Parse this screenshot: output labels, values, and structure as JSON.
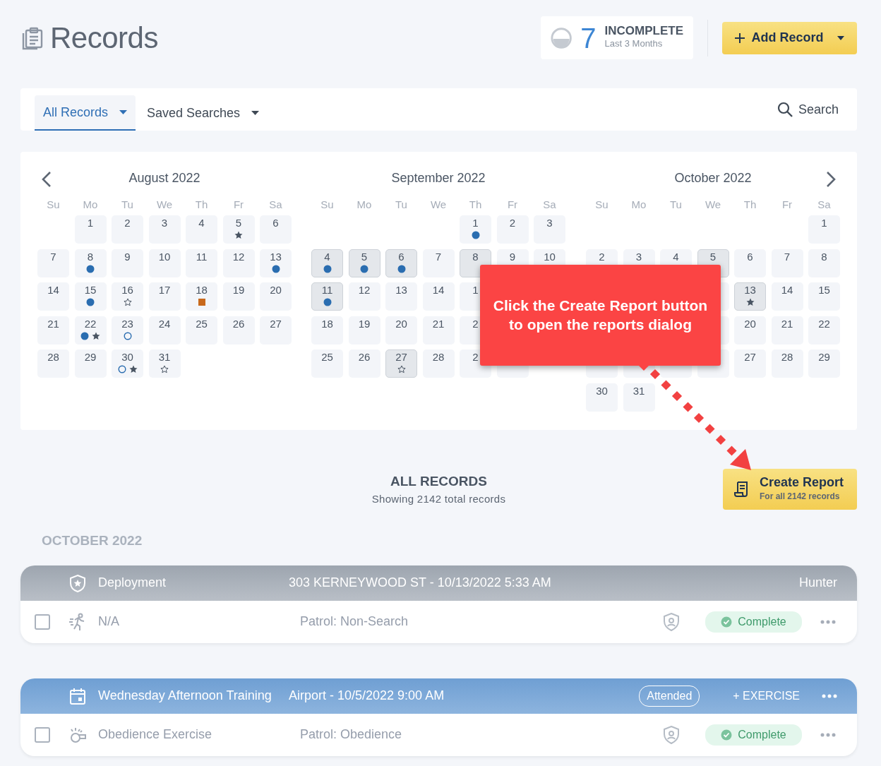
{
  "header": {
    "title": "Records",
    "incomplete": {
      "count": "7",
      "label": "INCOMPLETE",
      "period": "Last 3 Months"
    },
    "add_button": "Add Record"
  },
  "tabs": [
    {
      "label": "All Records",
      "selected": true
    },
    {
      "label": "Saved Searches",
      "selected": false
    }
  ],
  "search": "Search",
  "calendar": {
    "months": [
      {
        "title": "August 2022",
        "weekdays": [
          "Su",
          "Mo",
          "Tu",
          "We",
          "Th",
          "Fr",
          "Sa"
        ],
        "weeks": [
          [
            {
              "kind": "blank"
            },
            {
              "kind": "day",
              "day": "1",
              "selected": false
            },
            {
              "kind": "day",
              "day": "2",
              "selected": false
            },
            {
              "kind": "day",
              "day": "3",
              "selected": false
            },
            {
              "kind": "day",
              "day": "4",
              "selected": false
            },
            {
              "kind": "day",
              "day": "5",
              "selected": false,
              "marks": [
                {
                  "kind": "star"
                }
              ]
            },
            {
              "kind": "day",
              "day": "6",
              "selected": false
            }
          ],
          [
            {
              "kind": "day",
              "day": "7",
              "selected": false
            },
            {
              "kind": "day",
              "day": "8",
              "selected": false,
              "marks": [
                {
                  "kind": "dot"
                }
              ]
            },
            {
              "kind": "day",
              "day": "9",
              "selected": false
            },
            {
              "kind": "day",
              "day": "10",
              "selected": false
            },
            {
              "kind": "day",
              "day": "11",
              "selected": false
            },
            {
              "kind": "day",
              "day": "12",
              "selected": false
            },
            {
              "kind": "day",
              "day": "13",
              "selected": false,
              "marks": [
                {
                  "kind": "dot"
                }
              ]
            }
          ],
          [
            {
              "kind": "day",
              "day": "14",
              "selected": false
            },
            {
              "kind": "day",
              "day": "15",
              "selected": false,
              "marks": [
                {
                  "kind": "dot"
                }
              ]
            },
            {
              "kind": "day",
              "day": "16",
              "selected": false,
              "marks": [
                {
                  "kind": "star-outline"
                }
              ]
            },
            {
              "kind": "day",
              "day": "17",
              "selected": false
            },
            {
              "kind": "day",
              "day": "18",
              "selected": false,
              "marks": [
                {
                  "kind": "square"
                }
              ]
            },
            {
              "kind": "day",
              "day": "19",
              "selected": false
            },
            {
              "kind": "day",
              "day": "20",
              "selected": false
            }
          ],
          [
            {
              "kind": "day",
              "day": "21",
              "selected": false
            },
            {
              "kind": "day",
              "day": "22",
              "selected": false,
              "marks": [
                {
                  "kind": "dot"
                },
                {
                  "kind": "star"
                }
              ]
            },
            {
              "kind": "day",
              "day": "23",
              "selected": false,
              "marks": [
                {
                  "kind": "ring"
                }
              ]
            },
            {
              "kind": "day",
              "day": "24",
              "selected": false
            },
            {
              "kind": "day",
              "day": "25",
              "selected": false
            },
            {
              "kind": "day",
              "day": "26",
              "selected": false
            },
            {
              "kind": "day",
              "day": "27",
              "selected": false
            }
          ],
          [
            {
              "kind": "day",
              "day": "28",
              "selected": false
            },
            {
              "kind": "day",
              "day": "29",
              "selected": false
            },
            {
              "kind": "day",
              "day": "30",
              "selected": false,
              "marks": [
                {
                  "kind": "ring"
                },
                {
                  "kind": "star"
                }
              ]
            },
            {
              "kind": "day",
              "day": "31",
              "selected": false,
              "marks": [
                {
                  "kind": "star-outline"
                }
              ]
            }
          ]
        ]
      },
      {
        "title": "September 2022",
        "weekdays": [
          "Su",
          "Mo",
          "Tu",
          "We",
          "Th",
          "Fr",
          "Sa"
        ],
        "weeks": [
          [
            {
              "kind": "blank"
            },
            {
              "kind": "blank"
            },
            {
              "kind": "blank"
            },
            {
              "kind": "blank"
            },
            {
              "kind": "day",
              "day": "1",
              "selected": false,
              "marks": [
                {
                  "kind": "dot"
                }
              ]
            },
            {
              "kind": "day",
              "day": "2",
              "selected": false
            },
            {
              "kind": "day",
              "day": "3",
              "selected": false
            }
          ],
          [
            {
              "kind": "day",
              "day": "4",
              "selected": true,
              "marks": [
                {
                  "kind": "dot"
                }
              ]
            },
            {
              "kind": "day",
              "day": "5",
              "selected": true,
              "marks": [
                {
                  "kind": "dot"
                }
              ]
            },
            {
              "kind": "day",
              "day": "6",
              "selected": true,
              "marks": [
                {
                  "kind": "dot"
                }
              ]
            },
            {
              "kind": "day",
              "day": "7",
              "selected": false
            },
            {
              "kind": "day",
              "day": "8",
              "selected": true
            },
            {
              "kind": "day",
              "day": "9",
              "selected": false
            },
            {
              "kind": "day",
              "day": "10",
              "selected": false
            }
          ],
          [
            {
              "kind": "day",
              "day": "11",
              "selected": true,
              "marks": [
                {
                  "kind": "dot"
                }
              ]
            },
            {
              "kind": "day",
              "day": "12",
              "selected": false
            },
            {
              "kind": "day",
              "day": "13",
              "selected": false
            },
            {
              "kind": "day",
              "day": "14",
              "selected": false
            },
            {
              "kind": "day",
              "day": "1",
              "selected": false
            },
            {
              "kind": "covered"
            },
            {
              "kind": "covered"
            }
          ],
          [
            {
              "kind": "day",
              "day": "18",
              "selected": false
            },
            {
              "kind": "day",
              "day": "19",
              "selected": false
            },
            {
              "kind": "day",
              "day": "20",
              "selected": false
            },
            {
              "kind": "day",
              "day": "21",
              "selected": false
            },
            {
              "kind": "day",
              "day": "2",
              "selected": false
            },
            {
              "kind": "covered"
            },
            {
              "kind": "covered"
            }
          ],
          [
            {
              "kind": "day",
              "day": "25",
              "selected": false
            },
            {
              "kind": "day",
              "day": "26",
              "selected": false
            },
            {
              "kind": "day",
              "day": "27",
              "selected": true,
              "marks": [
                {
                  "kind": "star-outline"
                }
              ]
            },
            {
              "kind": "day",
              "day": "28",
              "selected": false
            },
            {
              "kind": "day",
              "day": "2",
              "selected": false
            },
            {
              "kind": "covered"
            }
          ]
        ]
      },
      {
        "title": "October 2022",
        "weekdays": [
          "Su",
          "Mo",
          "Tu",
          "We",
          "Th",
          "Fr",
          "Sa"
        ],
        "weeks": [
          [
            {
              "kind": "blank"
            },
            {
              "kind": "blank"
            },
            {
              "kind": "blank"
            },
            {
              "kind": "blank"
            },
            {
              "kind": "blank"
            },
            {
              "kind": "blank"
            },
            {
              "kind": "day",
              "day": "1",
              "selected": false
            }
          ],
          [
            {
              "kind": "day",
              "day": "2",
              "selected": false
            },
            {
              "kind": "day",
              "day": "3",
              "selected": false
            },
            {
              "kind": "day",
              "day": "4",
              "selected": false
            },
            {
              "kind": "day",
              "day": "5",
              "selected": true
            },
            {
              "kind": "day",
              "day": "6",
              "selected": false
            },
            {
              "kind": "day",
              "day": "7",
              "selected": false
            },
            {
              "kind": "day",
              "day": "8",
              "selected": false
            }
          ],
          [
            {
              "kind": "covered"
            },
            {
              "kind": "covered"
            },
            {
              "kind": "covered"
            },
            {
              "kind": "covered"
            },
            {
              "kind": "day",
              "day": "13",
              "selected": true,
              "marks": [
                {
                  "kind": "star"
                }
              ]
            },
            {
              "kind": "day",
              "day": "14",
              "selected": false
            },
            {
              "kind": "day",
              "day": "15",
              "selected": false
            }
          ],
          [
            {
              "kind": "covered"
            },
            {
              "kind": "covered"
            },
            {
              "kind": "covered"
            },
            {
              "kind": "covered"
            },
            {
              "kind": "day",
              "day": "20",
              "selected": false
            },
            {
              "kind": "day",
              "day": "21",
              "selected": false
            },
            {
              "kind": "day",
              "day": "22",
              "selected": false
            }
          ],
          [
            {
              "kind": "covered"
            },
            {
              "kind": "covered"
            },
            {
              "kind": "covered"
            },
            {
              "kind": "covered"
            },
            {
              "kind": "day",
              "day": "27",
              "selected": false
            },
            {
              "kind": "day",
              "day": "28",
              "selected": false
            },
            {
              "kind": "day",
              "day": "29",
              "selected": false
            }
          ],
          [
            {
              "kind": "day",
              "day": "30",
              "selected": false
            },
            {
              "kind": "day",
              "day": "31",
              "selected": false
            }
          ]
        ]
      }
    ]
  },
  "callout": {
    "text": "Click the Create Report button to open the reports dialog"
  },
  "summary": {
    "title": "ALL RECORDS",
    "subtitle": "Showing 2142 total records"
  },
  "report_button": {
    "label": "Create Report",
    "sub": "For all 2142 records"
  },
  "group_title": "OCTOBER 2022",
  "records": [
    {
      "kind": "deployment",
      "title": "Deployment",
      "location": "303 KERNEYWOOD ST - 10/13/2022 5:33 AM",
      "handler": "Hunter",
      "entry": {
        "checked": false,
        "name": "N/A",
        "detail": "Patrol: Non-Search",
        "status": "Complete"
      }
    },
    {
      "kind": "training",
      "title": "Wednesday Afternoon Training",
      "location": "Airport - 10/5/2022 9:00 AM",
      "badge": "Attended",
      "action": "+ EXERCISE",
      "entry": {
        "checked": false,
        "name": "Obedience Exercise",
        "detail": "Patrol: Obedience",
        "status": "Complete"
      }
    }
  ]
}
